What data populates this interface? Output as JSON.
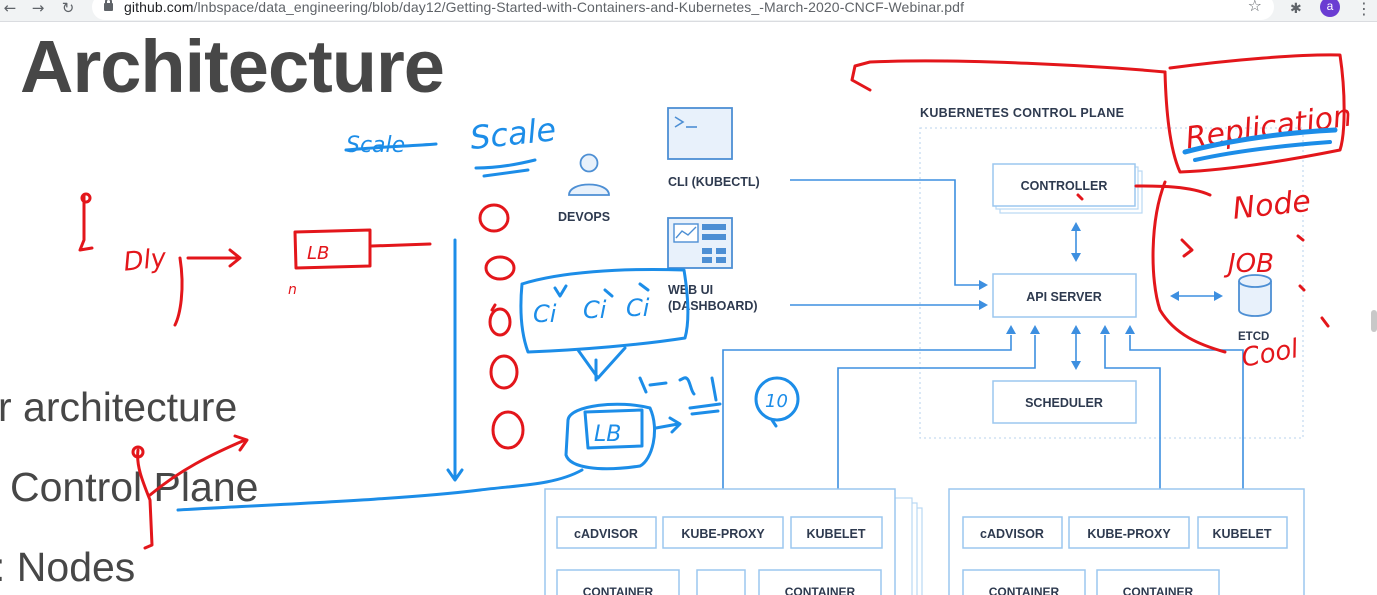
{
  "browser": {
    "url_host": "github.com",
    "url_path": "/lnbspace/data_engineering/blob/day12/Getting-Started-with-Containers-and-Kubernetes_-March-2020-CNCF-Webinar.pdf",
    "avatar_letter": "a"
  },
  "slide": {
    "title": "Architecture",
    "bullets": [
      "r architecture",
      "Control Plane",
      ": Nodes"
    ]
  },
  "diagram": {
    "devops_label": "DEVOPS",
    "cli_label": "CLI (KUBECTL)",
    "webui_label_1": "WEB UI",
    "webui_label_2": "(DASHBOARD)",
    "control_plane_label": "KUBERNETES CONTROL PLANE",
    "controller": "CONTROLLER",
    "api_server": "API SERVER",
    "scheduler": "SCHEDULER",
    "etcd": "ETCD",
    "node_components": [
      "cADVISOR",
      "KUBE-PROXY",
      "KUBELET"
    ],
    "container_label": "CONTAINER"
  },
  "annotations": {
    "replication": "Replication",
    "node": "Node",
    "job": "JOB",
    "cool": "Cool",
    "scale_struck": "Scale",
    "scale": "Scale",
    "dly": "Dly",
    "lb": "LB",
    "ten": "10",
    "ci": "Ci",
    "n": "n"
  }
}
